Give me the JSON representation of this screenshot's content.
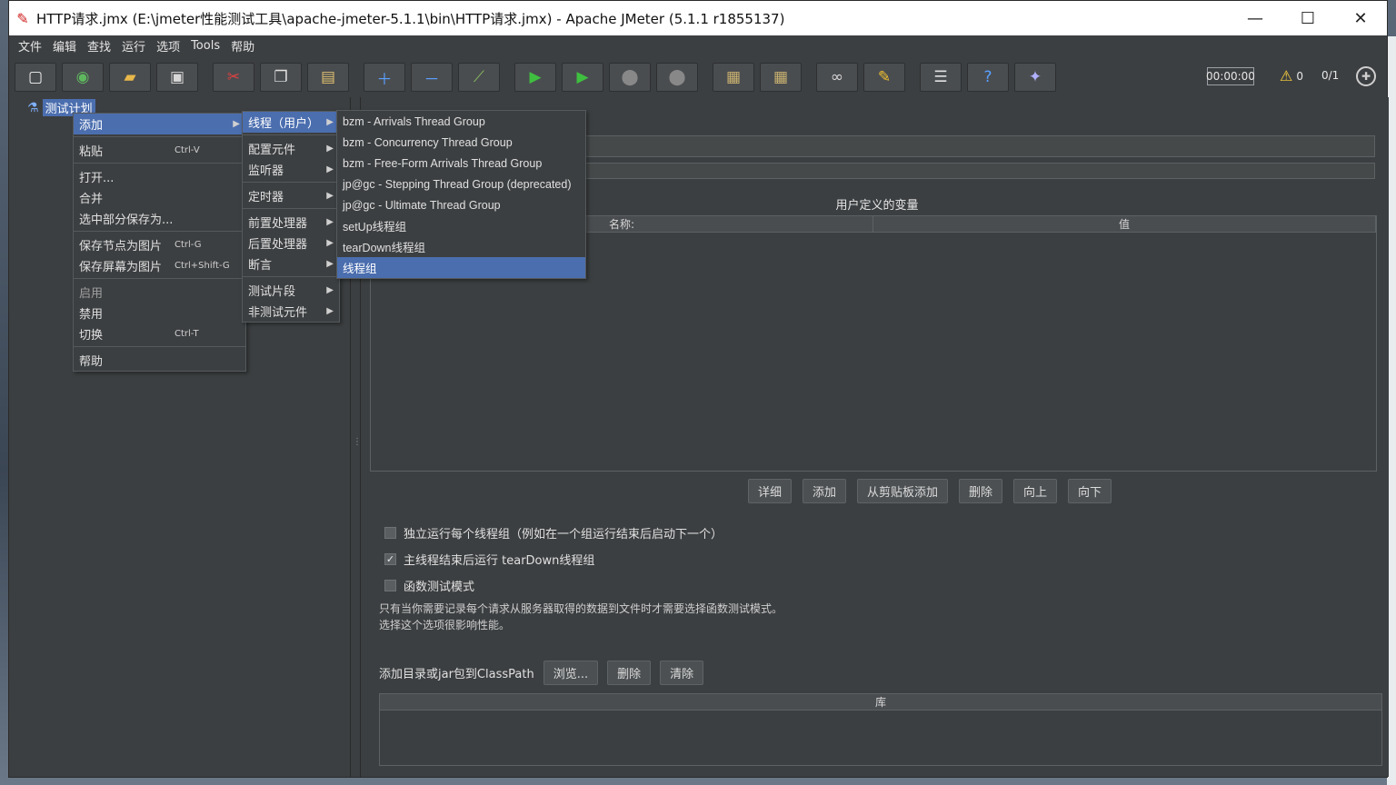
{
  "window": {
    "title": "HTTP请求.jmx (E:\\jmeter性能测试工具\\apache-jmeter-5.1.1\\bin\\HTTP请求.jmx) - Apache JMeter (5.1.1 r1855137)",
    "minimize": "—",
    "maximize": "☐",
    "close": "✕"
  },
  "menubar": [
    "文件",
    "编辑",
    "查找",
    "运行",
    "选项",
    "Tools",
    "帮助"
  ],
  "toolbar": {
    "icons": [
      "new-icon",
      "templates-icon",
      "open-icon",
      "save-icon",
      "cut-icon",
      "copy-icon",
      "paste-icon",
      "expand-icon",
      "collapse-icon",
      "toggle-icon",
      "start-icon",
      "start-no-pause-icon",
      "stop-icon",
      "shutdown-icon",
      "clear-icon",
      "clear-all-icon",
      "search-icon",
      "reset-search-icon",
      "function-helper-icon",
      "help-icon",
      "remote-icon"
    ],
    "timer": "00:00:00",
    "warnings": "0",
    "threads": "0/1"
  },
  "tree": {
    "root_label": "测试计划"
  },
  "context_menu": {
    "items": [
      {
        "label": "添加",
        "shortcut": "",
        "submenu": true
      },
      {
        "label": "粘贴",
        "shortcut": "Ctrl-V"
      },
      {
        "label": "打开...",
        "shortcut": ""
      },
      {
        "label": "合并",
        "shortcut": ""
      },
      {
        "label": "选中部分保存为...",
        "shortcut": ""
      },
      {
        "label": "保存节点为图片",
        "shortcut": "Ctrl-G"
      },
      {
        "label": "保存屏幕为图片",
        "shortcut": "Ctrl+Shift-G"
      },
      {
        "label": "启用",
        "shortcut": ""
      },
      {
        "label": "禁用",
        "shortcut": ""
      },
      {
        "label": "切换",
        "shortcut": "Ctrl-T"
      },
      {
        "label": "帮助",
        "shortcut": ""
      }
    ]
  },
  "add_submenu": [
    "线程（用户）",
    "配置元件",
    "监听器",
    "定时器",
    "前置处理器",
    "后置处理器",
    "断言",
    "测试片段",
    "非测试元件"
  ],
  "thread_submenu": [
    "bzm - Arrivals Thread Group",
    "bzm - Concurrency Thread Group",
    "bzm - Free-Form Arrivals Thread Group",
    "jp@gc - Stepping Thread Group (deprecated)",
    "jp@gc - Ultimate Thread Group",
    "setUp线程组",
    "tearDown线程组",
    "线程组"
  ],
  "panel": {
    "vars_title": "用户定义的变量",
    "col_name": "名称:",
    "col_value": "值",
    "buttons": [
      "详细",
      "添加",
      "从剪贴板添加",
      "删除",
      "向上",
      "向下"
    ],
    "checkbox1": "独立运行每个线程组（例如在一个组运行结束后启动下一个）",
    "checkbox2": "主线程结束后运行 tearDown线程组",
    "checkbox3": "函数测试模式",
    "note1": "只有当你需要记录每个请求从服务器取得的数据到文件时才需要选择函数测试模式。",
    "note2": "选择这个选项很影响性能。",
    "classpath_label": "添加目录或jar包到ClassPath",
    "cp_browse": "浏览...",
    "cp_delete": "删除",
    "cp_clear": "清除",
    "lib_header": "库"
  }
}
